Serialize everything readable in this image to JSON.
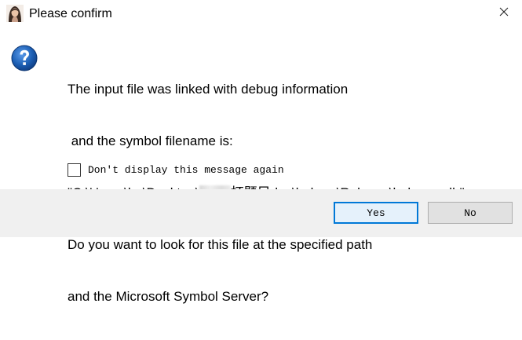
{
  "window": {
    "title": "Please confirm",
    "app_icon": "avatar-icon",
    "close_icon": "close-icon"
  },
  "dialog": {
    "icon": "question-icon",
    "message_lines": [
      "The input file was linked with debug information",
      " and the symbol filename is:",
      "\"C:\\Users\\hp\\Desktop\\",
      "杯题目dev\\babyre\\Release\\babyre.pdb\"",
      "Do you want to look for this file at the specified path",
      "and the Microsoft Symbol Server?"
    ],
    "checkbox_label": "Don't display this message again",
    "checkbox_checked": false
  },
  "buttons": {
    "yes_label": "Yes",
    "no_label": "No"
  },
  "colors": {
    "accent_border": "#0078d7",
    "footer_bg": "#f0f0f0",
    "question_blue": "#1c5fb4"
  }
}
